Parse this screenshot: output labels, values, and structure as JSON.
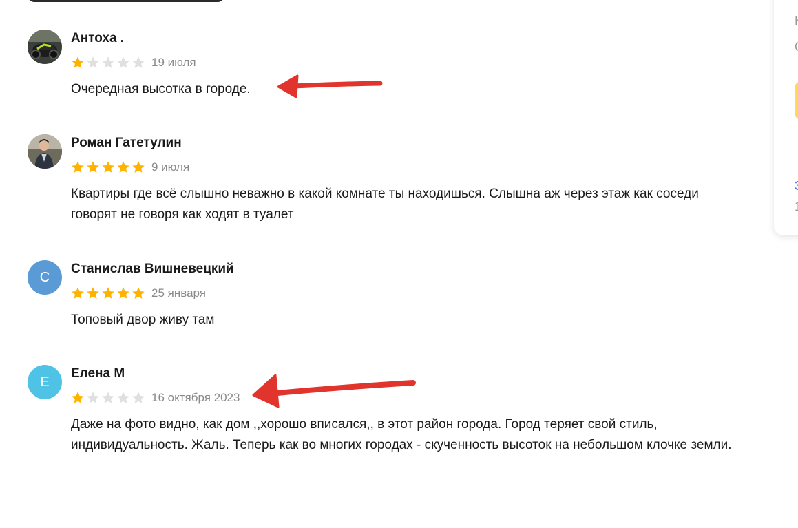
{
  "reviews": [
    {
      "author": "Антоха .",
      "rating": 1,
      "date": "19 июля",
      "text": "Очередная высотка в городе.",
      "avatar": {
        "type": "photo",
        "icon": "motorcycle-photo"
      }
    },
    {
      "author": "Роман Гатетулин",
      "rating": 5,
      "date": "9 июля",
      "text": "Квартиры где всё слышно неважно в какой комнате ты находишься. Слышна аж через этаж как соседи говорят не говоря как ходят в туалет",
      "avatar": {
        "type": "photo",
        "icon": "person-photo"
      }
    },
    {
      "author": "Станислав Вишневецкий",
      "rating": 5,
      "date": "25 января",
      "text": "Топовый двор живу там",
      "avatar": {
        "type": "letter",
        "letter": "С",
        "color": "#5b9bd5"
      }
    },
    {
      "author": "Елена М",
      "rating": 1,
      "date": "16 октября 2023",
      "text": "Даже на фото видно, как дом ,,хорошо вписался,, в этот район города. Город теряет свой стиль, индивидуальность. Жаль. Теперь как во многих городах - скученность высоток на небольшом клочке земли.",
      "avatar": {
        "type": "letter",
        "letter": "Е",
        "color": "#4fc3e6"
      }
    }
  ],
  "side_panel": {
    "fragments": [
      "Н",
      "О",
      "З",
      "1"
    ],
    "accent": "#ffdb4d"
  },
  "colors": {
    "star_filled": "#ffb300",
    "star_empty": "#e0e0e0",
    "annotation_arrow": "#e0342c"
  },
  "max_rating": 5
}
